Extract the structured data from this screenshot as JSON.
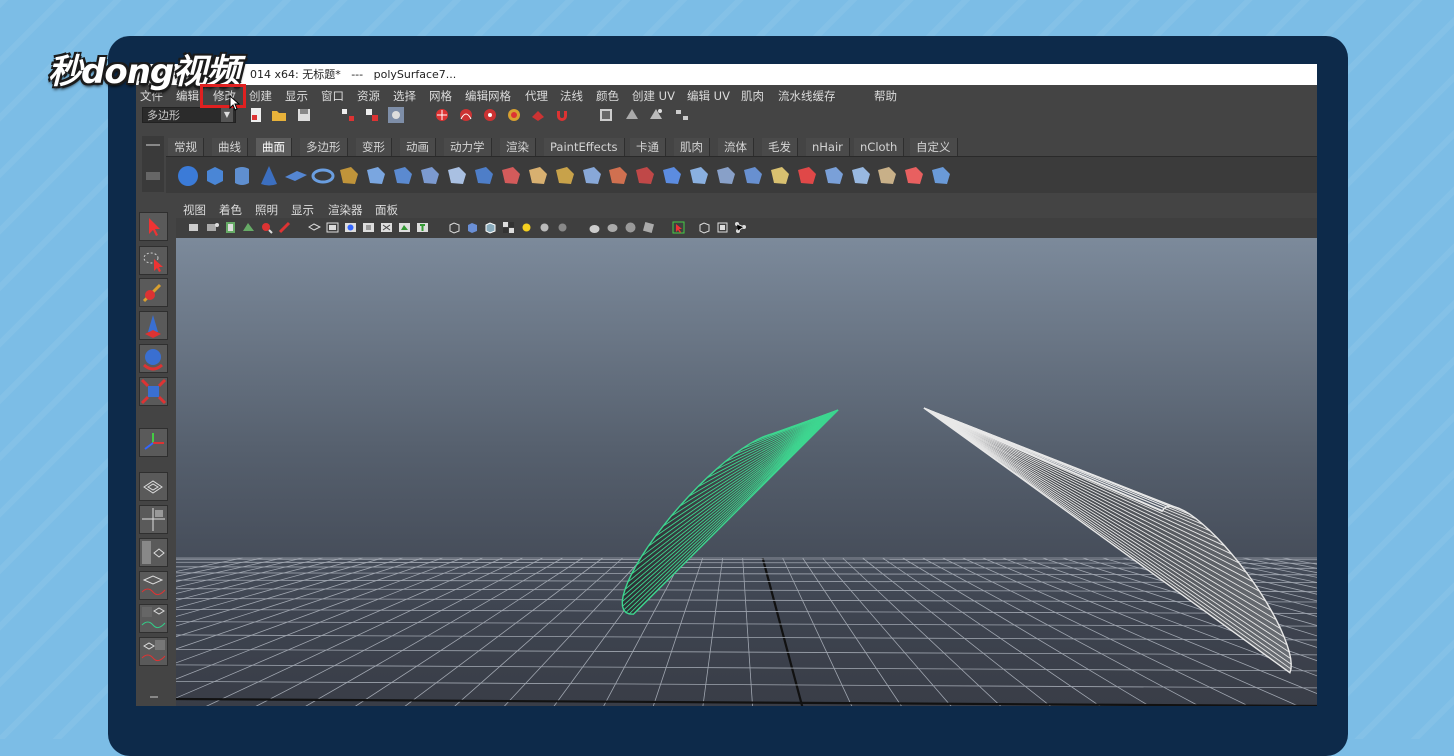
{
  "watermark": {
    "brand": "秒dong视频"
  },
  "window": {
    "title_fragment": "014 x64: 无标题*",
    "separator": "---",
    "object": "polySurface7..."
  },
  "menubar": [
    "文件",
    "编辑",
    "修改",
    "创建",
    "显示",
    "窗口",
    "资源",
    "选择",
    "网格",
    "编辑网格",
    "代理",
    "法线",
    "颜色",
    "创建 UV",
    "编辑 UV",
    "肌肉",
    "流水线缓存",
    "帮助"
  ],
  "highlighted_menu": "修改",
  "mode_selector": {
    "value": "多边形"
  },
  "shelf_tabs": [
    "常规",
    "曲线",
    "曲面",
    "多边形",
    "变形",
    "动画",
    "动力学",
    "渲染",
    "PaintEffects",
    "卡通",
    "肌肉",
    "流体",
    "毛发",
    "nHair",
    "nCloth",
    "自定义"
  ],
  "active_shelf_tab": "曲面",
  "viewport_menu": [
    "视图",
    "着色",
    "照明",
    "显示",
    "渲染器",
    "面板"
  ],
  "shelf_icons": [
    "sphere-icon",
    "cube-icon",
    "cylinder-icon",
    "cone-icon",
    "plane-icon",
    "torus-icon",
    "revolve-icon",
    "loft-icon",
    "planar-icon",
    "extrude-icon",
    "birail-icon",
    "boundary-icon",
    "square-icon",
    "bevel-icon",
    "bevel-plus-icon",
    "project-curve-icon",
    "intersect-icon",
    "trim-icon",
    "untrim-icon",
    "attach-icon",
    "detach-icon",
    "align-icon",
    "open-close-icon",
    "insert-isoparm-icon",
    "extend-icon",
    "offset-icon",
    "rebuild-icon",
    "sculpt-icon",
    "paint-icon"
  ],
  "colors": {
    "selected_wire": "#3ed690",
    "unselected_wire": "#e8e8e8",
    "highlight_box": "#e02020",
    "laptop_bezel": "#0d2a4a",
    "background": "#7cbde6"
  }
}
